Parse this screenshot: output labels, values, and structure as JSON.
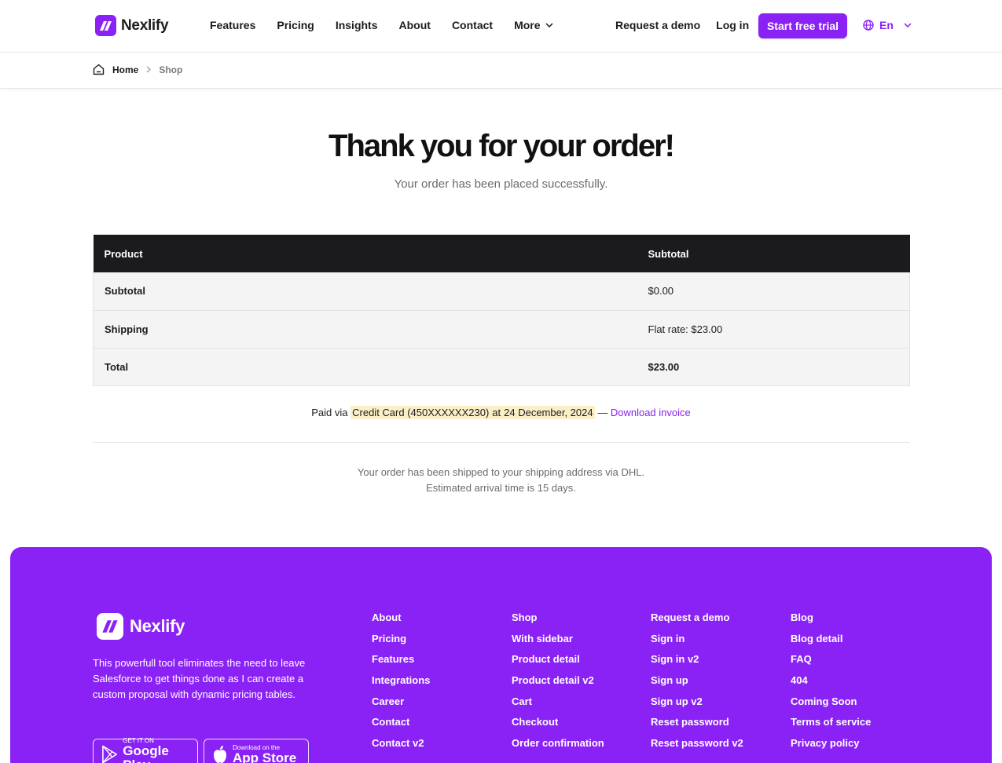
{
  "header": {
    "logo_text": "Nexlify",
    "nav": [
      "Features",
      "Pricing",
      "Insights",
      "About",
      "Contact",
      "More"
    ],
    "request_demo": "Request a demo",
    "login": "Log in",
    "cta": "Start free trial",
    "lang": "En"
  },
  "breadcrumb": {
    "home": "Home",
    "current": "Shop"
  },
  "main": {
    "title": "Thank you for your order!",
    "subtitle": "Your order has been placed successfully."
  },
  "table": {
    "headers": [
      "Product",
      "Subtotal"
    ],
    "rows": [
      {
        "label": "Subtotal",
        "value": "$0.00"
      },
      {
        "label": "Shipping",
        "value": "Flat rate: $23.00"
      },
      {
        "label": "Total",
        "value": "$23.00"
      }
    ]
  },
  "payment": {
    "prefix": "Paid via",
    "method": "Credit Card (450XXXXXX230)",
    "at": "at",
    "date": "24 December, 2024",
    "dash": "—",
    "invoice_link": "Download invoice"
  },
  "shipping_note": {
    "line1": "Your order has been shipped to your shipping address via DHL.",
    "line2": "Estimated arrival time is 15 days."
  },
  "footer": {
    "logo_text": "Nexlify",
    "description": "This powerfull tool eliminates the need to leave Salesforce to get things done as I can create a custom proposal with dynamic pricing tables.",
    "google_play": {
      "small": "GET IT ON",
      "big": "Google Play"
    },
    "app_store": {
      "small": "Download on the",
      "big": "App Store"
    },
    "columns": [
      [
        "About",
        "Pricing",
        "Features",
        "Integrations",
        "Career",
        "Contact",
        "Contact v2"
      ],
      [
        "Shop",
        "With sidebar",
        "Product detail",
        "Product detail v2",
        "Cart",
        "Checkout",
        "Order confirmation"
      ],
      [
        "Request a demo",
        "Sign in",
        "Sign in v2",
        "Sign up",
        "Sign up v2",
        "Reset password",
        "Reset password v2"
      ],
      [
        "Blog",
        "Blog detail",
        "FAQ",
        "404",
        "Coming Soon",
        "Terms of service",
        "Privacy policy"
      ]
    ]
  },
  "colors": {
    "brand": "#8b22f5",
    "table_header": "#1b1b1d",
    "highlight": "#fbefc7"
  }
}
